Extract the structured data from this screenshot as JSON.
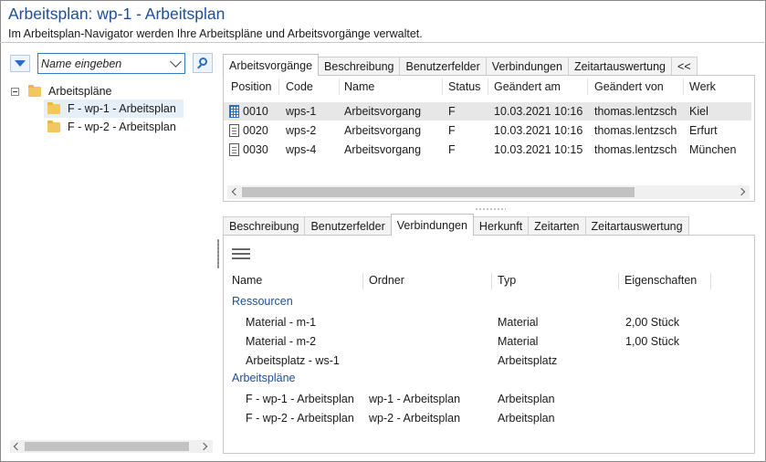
{
  "header": {
    "title": "Arbeitsplan: wp-1 - Arbeitsplan",
    "subtitle": "Im Arbeitsplan-Navigator werden Ihre Arbeitspläne und Arbeitsvorgänge verwaltet."
  },
  "navigator": {
    "search_placeholder": "Name eingeben",
    "tree": {
      "root": "Arbeitspläne",
      "children": [
        "F - wp-1 - Arbeitsplan",
        "F - wp-2 - Arbeitsplan"
      ]
    }
  },
  "top_tabs": [
    "Arbeitsvorgänge",
    "Beschreibung",
    "Benutzerfelder",
    "Verbindungen",
    "Zeitartauswertung",
    "<<"
  ],
  "operations": {
    "columns": [
      "Position",
      "Code",
      "Name",
      "Status",
      "Geändert am",
      "Geändert von",
      "Werk"
    ],
    "rows": [
      {
        "position": "0010",
        "code": "wps-1",
        "name": "Arbeitsvorgang",
        "status": "F",
        "changed_at": "10.03.2021 10:16",
        "changed_by": "thomas.lentzsch",
        "plant": "Kiel"
      },
      {
        "position": "0020",
        "code": "wps-2",
        "name": "Arbeitsvorgang",
        "status": "F",
        "changed_at": "10.03.2021 10:16",
        "changed_by": "thomas.lentzsch",
        "plant": "Erfurt"
      },
      {
        "position": "0030",
        "code": "wps-4",
        "name": "Arbeitsvorgang",
        "status": "F",
        "changed_at": "10.03.2021 10:15",
        "changed_by": "thomas.lentzsch",
        "plant": "München"
      }
    ]
  },
  "bottom_tabs": [
    "Beschreibung",
    "Benutzerfelder",
    "Verbindungen",
    "Herkunft",
    "Zeitarten",
    "Zeitartauswertung"
  ],
  "connections": {
    "columns": [
      "Name",
      "Ordner",
      "Typ",
      "Eigenschaften"
    ],
    "groups": [
      {
        "label": "Ressourcen",
        "rows": [
          {
            "name": "Material - m-1",
            "folder": "",
            "type": "Material",
            "props": "2,00 Stück"
          },
          {
            "name": "Material - m-2",
            "folder": "",
            "type": "Material",
            "props": "1,00 Stück"
          },
          {
            "name": "Arbeitsplatz - ws-1",
            "folder": "",
            "type": "Arbeitsplatz",
            "props": ""
          }
        ]
      },
      {
        "label": "Arbeitspläne",
        "rows": [
          {
            "name": "F - wp-1 - Arbeitsplan",
            "folder": "wp-1 - Arbeitsplan",
            "type": "Arbeitsplan",
            "props": ""
          },
          {
            "name": "F - wp-2 - Arbeitsplan",
            "folder": "wp-2 - Arbeitsplan",
            "type": "Arbeitsplan",
            "props": ""
          }
        ]
      }
    ]
  },
  "colors": {
    "accent": "#1f4e99",
    "selected_row": "#e7e7e7"
  }
}
